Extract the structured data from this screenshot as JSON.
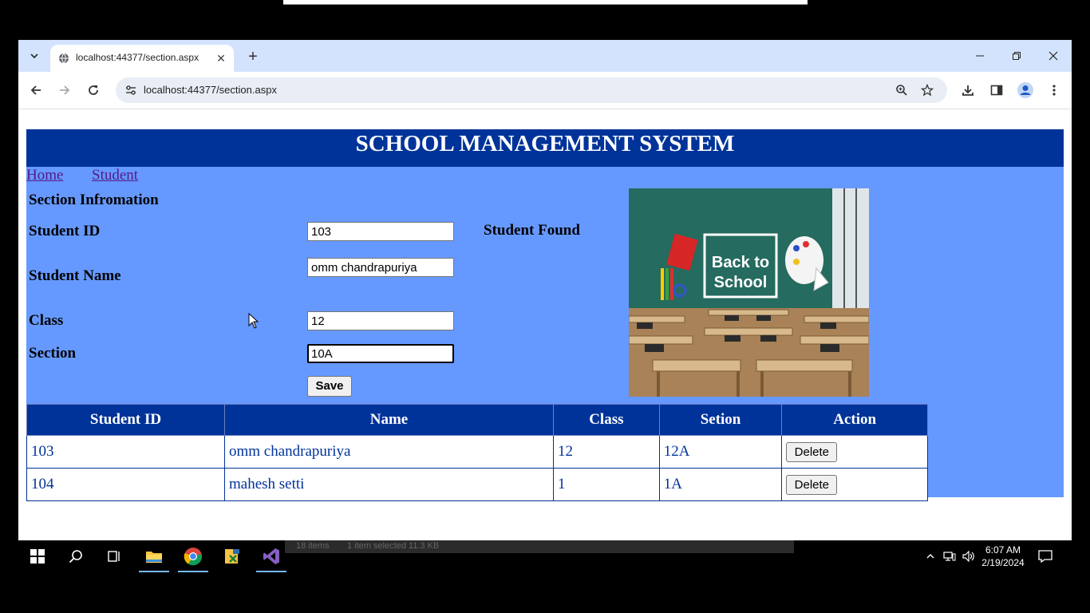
{
  "browser": {
    "tab_title": "localhost:44377/section.aspx",
    "url": "localhost:44377/section.aspx"
  },
  "page": {
    "header_title": "SCHOOL MANAGEMENT SYSTEM",
    "nav": {
      "home": "Home",
      "student": "Student"
    },
    "form": {
      "section_heading": "Section Infromation",
      "student_id_label": "Student ID",
      "student_id_value": "103",
      "status_message": "Student Found",
      "student_name_label": "Student Name",
      "student_name_value": "omm chandrapuriya",
      "class_label": "Class",
      "class_value": "12",
      "section_label": "Section",
      "section_value": "10A",
      "save_label": "Save"
    },
    "image": {
      "text_line1": "Back to",
      "text_line2": "School"
    },
    "table": {
      "headers": [
        "Student ID",
        "Name",
        "Class",
        "Setion",
        "Action"
      ],
      "rows": [
        {
          "id": "103",
          "name": "omm chandrapuriya",
          "class": "12",
          "section": "12A",
          "action": "Delete"
        },
        {
          "id": "104",
          "name": "mahesh setti",
          "class": "1",
          "section": "1A",
          "action": "Delete"
        }
      ]
    }
  },
  "taskbar": {
    "time": "6:07 AM",
    "date": "2/19/2024",
    "explorer_status_items": "18 items",
    "explorer_status_selected": "1 item selected  11.3 KB"
  },
  "colors": {
    "header_bg": "#003399",
    "content_bg": "#6699ff",
    "table_text": "#003399",
    "link": "#551a8b"
  }
}
